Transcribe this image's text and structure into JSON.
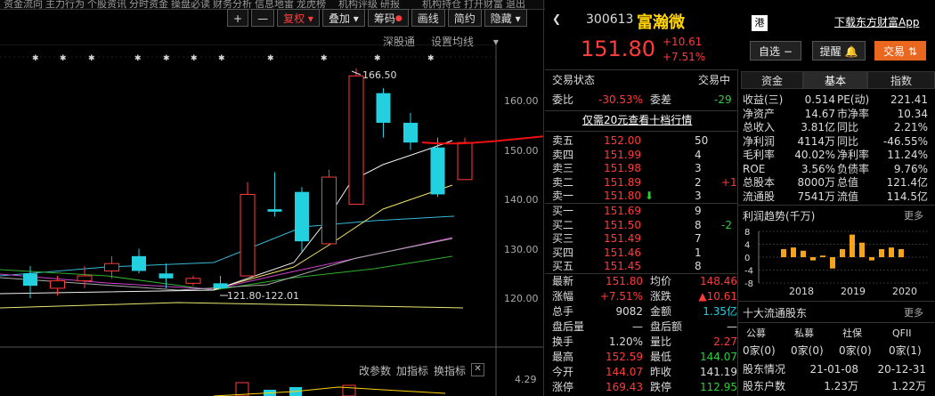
{
  "topbar": {
    "items": [
      "资金流向",
      "主力行为",
      "个股资讯",
      "分时资金",
      "操盘必读",
      "财务分析",
      "信息地雷",
      "龙虎榜",
      "机构评级",
      "研报",
      "机构持仓",
      "打开财富",
      "退出"
    ]
  },
  "toolbar": {
    "plus": "+",
    "minus": "—",
    "fuquan": "复权",
    "fuquan_arrow": "▾",
    "overlay": "叠加",
    "overlay_arrow": "▾",
    "chips": "筹码",
    "drawline": "画线",
    "simple": "简约",
    "hide": "隐藏",
    "hide_arrow": "▾"
  },
  "subnav": {
    "sgt": "深股通",
    "ma_settings": "设置均线",
    "ma_arrow": "▾"
  },
  "chart": {
    "high_label": "166.50",
    "low_label": "121.80-122.01",
    "y_labels": [
      "160.00",
      "150.00",
      "140.00",
      "130.00",
      "120.00"
    ],
    "vol_label": "4.29",
    "ctrl": {
      "params": "改参数",
      "add": "加指标",
      "switch": "换指标",
      "close": "✕"
    }
  },
  "chart_data": {
    "type": "candlestick",
    "ylim": [
      115,
      170
    ],
    "candles": [
      {
        "o": 122.5,
        "h": 126.5,
        "l": 120.0,
        "c": 125.0,
        "color": "cyan"
      },
      {
        "o": 122.0,
        "h": 124.5,
        "l": 120.5,
        "c": 123.5,
        "color": "red"
      },
      {
        "o": 123.5,
        "h": 126.5,
        "l": 122.0,
        "c": 124.5,
        "color": "red"
      },
      {
        "o": 125.5,
        "h": 128.5,
        "l": 124.0,
        "c": 127.0,
        "color": "red"
      },
      {
        "o": 128.5,
        "h": 130.0,
        "l": 125.0,
        "c": 125.5,
        "color": "cyan"
      },
      {
        "o": 125.0,
        "h": 127.0,
        "l": 122.0,
        "c": 124.0,
        "color": "cyan"
      },
      {
        "o": 123.0,
        "h": 124.5,
        "l": 122.5,
        "c": 124.0,
        "color": "red"
      },
      {
        "o": 123.0,
        "h": 124.5,
        "l": 121.8,
        "c": 122.0,
        "color": "cyan"
      },
      {
        "o": 124.5,
        "h": 143.5,
        "l": 124.5,
        "c": 141.0,
        "color": "red"
      },
      {
        "o": 138.0,
        "h": 145.5,
        "l": 136.5,
        "c": 137.5,
        "color": "cyan"
      },
      {
        "o": 141.5,
        "h": 142.5,
        "l": 129.5,
        "c": 131.5,
        "color": "cyan"
      },
      {
        "o": 131.0,
        "h": 146.0,
        "l": 131.0,
        "c": 144.5,
        "color": "red"
      },
      {
        "o": 139.0,
        "h": 166.5,
        "l": 139.0,
        "c": 165.0,
        "color": "red"
      },
      {
        "o": 161.5,
        "h": 162.5,
        "l": 152.5,
        "c": 155.5,
        "color": "cyan"
      },
      {
        "o": 155.5,
        "h": 157.5,
        "l": 150.0,
        "c": 151.5,
        "color": "cyan"
      },
      {
        "o": 150.5,
        "h": 152.5,
        "l": 140.5,
        "c": 141.0,
        "color": "cyan"
      },
      {
        "o": 144.0,
        "h": 152.5,
        "l": 144.0,
        "c": 151.5,
        "color": "red"
      }
    ]
  },
  "quote": {
    "code": "300613",
    "name": "富瀚微",
    "market": "港",
    "download": "下载东方财富App",
    "price": "151.80",
    "change": "+10.61",
    "pct": "+7.51%",
    "self_select": "自选",
    "minus": "−",
    "remind": "提醒",
    "bell": "🔔",
    "trade": "交易",
    "trade_arrow": "⇅"
  },
  "status": {
    "label": "交易状态",
    "value": "交易中",
    "webi_l": "委比",
    "webi_v": "-30.53%",
    "weicha_l": "委差",
    "weicha_v": "-29",
    "promo": "仅需20元查看十档行情"
  },
  "asks": [
    {
      "label": "卖五",
      "price": "152.00",
      "vol": "50",
      "chg": ""
    },
    {
      "label": "卖四",
      "price": "151.99",
      "vol": "4",
      "chg": ""
    },
    {
      "label": "卖三",
      "price": "151.98",
      "vol": "3",
      "chg": ""
    },
    {
      "label": "卖二",
      "price": "151.89",
      "vol": "2",
      "chg": "+1"
    },
    {
      "label": "卖一",
      "price": "151.80",
      "vol": "3",
      "chg": ""
    }
  ],
  "bids": [
    {
      "label": "买一",
      "price": "151.69",
      "vol": "9",
      "chg": ""
    },
    {
      "label": "买二",
      "price": "151.50",
      "vol": "8",
      "chg": "-2"
    },
    {
      "label": "买三",
      "price": "151.49",
      "vol": "7",
      "chg": ""
    },
    {
      "label": "买四",
      "price": "151.46",
      "vol": "1",
      "chg": ""
    },
    {
      "label": "买五",
      "price": "151.45",
      "vol": "8",
      "chg": ""
    }
  ],
  "ask_arrow": "⬇",
  "stats": [
    {
      "l1": "最新",
      "v1": "151.80",
      "l2": "均价",
      "v2": "148.46"
    },
    {
      "l1": "涨幅",
      "v1": "+7.51%",
      "l2": "涨跌",
      "v2": "▲10.61"
    },
    {
      "l1": "总手",
      "v1": "9082",
      "l2": "金额",
      "v2": "1.35亿"
    },
    {
      "l1": "盘后量",
      "v1": "—",
      "l2": "盘后额",
      "v2": "—"
    },
    {
      "l1": "换手",
      "v1": "1.20%",
      "l2": "量比",
      "v2": "2.27"
    },
    {
      "l1": "最高",
      "v1": "152.59",
      "l2": "最低",
      "v2": "144.07"
    },
    {
      "l1": "今开",
      "v1": "144.07",
      "l2": "昨收",
      "v2": "141.19"
    },
    {
      "l1": "涨停",
      "v1": "169.43",
      "l2": "跌停",
      "v2": "112.95"
    }
  ],
  "tabs": [
    "资金",
    "基本",
    "指数"
  ],
  "fundamentals": [
    {
      "l1": "收益(三)",
      "v1": "0.514",
      "l2": "PE(动)",
      "v2": "221.41"
    },
    {
      "l1": "净资产",
      "v1": "14.67",
      "l2": "市净率",
      "v2": "10.34"
    },
    {
      "l1": "总收入",
      "v1": "3.81亿",
      "l2": "同比",
      "v2": "2.21%"
    },
    {
      "l1": "净利润",
      "v1": "4114万",
      "l2": "同比",
      "v2": "-46.55%"
    },
    {
      "l1": "毛利率",
      "v1": "40.02%",
      "l2": "净利率",
      "v2": "11.24%"
    },
    {
      "l1": "ROE",
      "v1": "3.56%",
      "l2": "负债率",
      "v2": "9.76%"
    },
    {
      "l1": "总股本",
      "v1": "8000万",
      "l2": "总值",
      "v2": "121.4亿"
    },
    {
      "l1": "流通股",
      "v1": "7541万",
      "l2": "流值",
      "v2": "114.5亿"
    }
  ],
  "profit": {
    "title": "利润趋势(千万)",
    "more": "更多",
    "y_ticks": [
      "8",
      "4",
      "0",
      "-4",
      "-8"
    ],
    "years": [
      "2018",
      "2019",
      "2020"
    ],
    "bars": [
      2.5,
      3.0,
      2.0,
      -1.0,
      0.5,
      -3.5,
      2.5,
      7.0,
      4.5,
      -1.0,
      2.5,
      3.0,
      2.5
    ]
  },
  "holders": {
    "title": "十大流通股东",
    "more": "更多",
    "headers": [
      "公募",
      "私募",
      "社保",
      "QFII"
    ],
    "values": [
      "0家(0)",
      "0家(0)",
      "0家(0)",
      "0家(1)"
    ],
    "r1_label": "股东情况",
    "r1_a": "21-01-08",
    "r1_b": "20-12-31",
    "r2_label": "股东户数",
    "r2_a": "1.23万",
    "r2_b": "1.22万"
  }
}
